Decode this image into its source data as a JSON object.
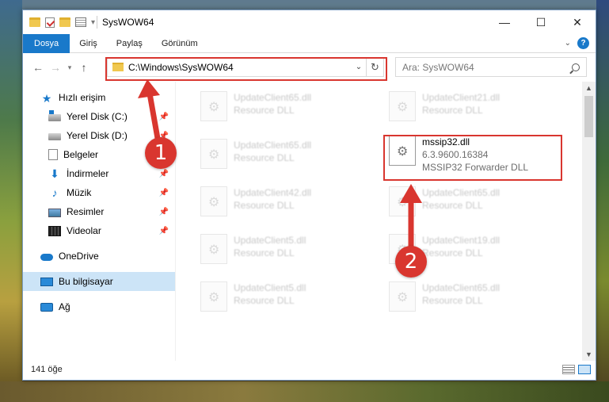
{
  "window": {
    "title": "SysWOW64",
    "controls": {
      "minimize": "—",
      "maximize": "☐",
      "close": "✕"
    }
  },
  "ribbon": {
    "tabs": [
      "Dosya",
      "Giriş",
      "Paylaş",
      "Görünüm"
    ],
    "active_tab": "Dosya",
    "expand_icon": "chevron-down-icon",
    "help_label": "?"
  },
  "navigation": {
    "back": "←",
    "forward": "→",
    "recent": "▾",
    "up": "↑",
    "address_path": "C:\\Windows\\SysWOW64",
    "address_dropdown": "⌄",
    "refresh": "↻",
    "search_placeholder": "Ara: SysWOW64"
  },
  "sidebar": {
    "items": [
      {
        "label": "Hızlı erişim",
        "icon": "star-icon",
        "pinned": false
      },
      {
        "label": "Yerel Disk (C:)",
        "icon": "drive-c-icon",
        "pinned": true
      },
      {
        "label": "Yerel Disk (D:)",
        "icon": "drive-d-icon",
        "pinned": true
      },
      {
        "label": "Belgeler",
        "icon": "documents-icon",
        "pinned": true
      },
      {
        "label": "İndirmeler",
        "icon": "downloads-icon",
        "pinned": true
      },
      {
        "label": "Müzik",
        "icon": "music-icon",
        "pinned": true
      },
      {
        "label": "Resimler",
        "icon": "pictures-icon",
        "pinned": true
      },
      {
        "label": "Videolar",
        "icon": "videos-icon",
        "pinned": true
      },
      {
        "label": "OneDrive",
        "icon": "onedrive-icon",
        "pinned": false
      },
      {
        "label": "Bu bilgisayar",
        "icon": "this-pc-icon",
        "pinned": false,
        "selected": true
      },
      {
        "label": "Ağ",
        "icon": "network-icon",
        "pinned": false
      }
    ]
  },
  "files": [
    {
      "name": "UpdateClient65.dll",
      "desc": "Resource DLL",
      "blurred": true
    },
    {
      "name": "UpdateClient21.dll",
      "desc": "Resource DLL",
      "blurred": true
    },
    {
      "name": "UpdateClient65.dll",
      "desc": "Resource DLL",
      "blurred": true
    },
    {
      "name": "mssip32.dll",
      "version": "6.3.9600.16384",
      "desc": "MSSIP32 Forwarder DLL",
      "blurred": false,
      "highlighted": true
    },
    {
      "name": "UpdateClient42.dll",
      "desc": "Resource DLL",
      "blurred": true
    },
    {
      "name": "UpdateClient65.dll",
      "desc": "Resource DLL",
      "blurred": true
    },
    {
      "name": "UpdateClient5.dll",
      "desc": "Resource DLL",
      "blurred": true
    },
    {
      "name": "UpdateClient19.dll",
      "desc": "Resource DLL",
      "blurred": true
    },
    {
      "name": "UpdateClient5.dll",
      "desc": "Resource DLL",
      "blurred": true
    },
    {
      "name": "UpdateClient65.dll",
      "desc": "Resource DLL",
      "blurred": true
    }
  ],
  "status": {
    "item_count": "141 öğe"
  },
  "annotations": {
    "step1": "1",
    "step2": "2",
    "color": "#d9362f"
  },
  "colors": {
    "accent": "#1979ca",
    "selected_bg": "#cce4f7"
  }
}
